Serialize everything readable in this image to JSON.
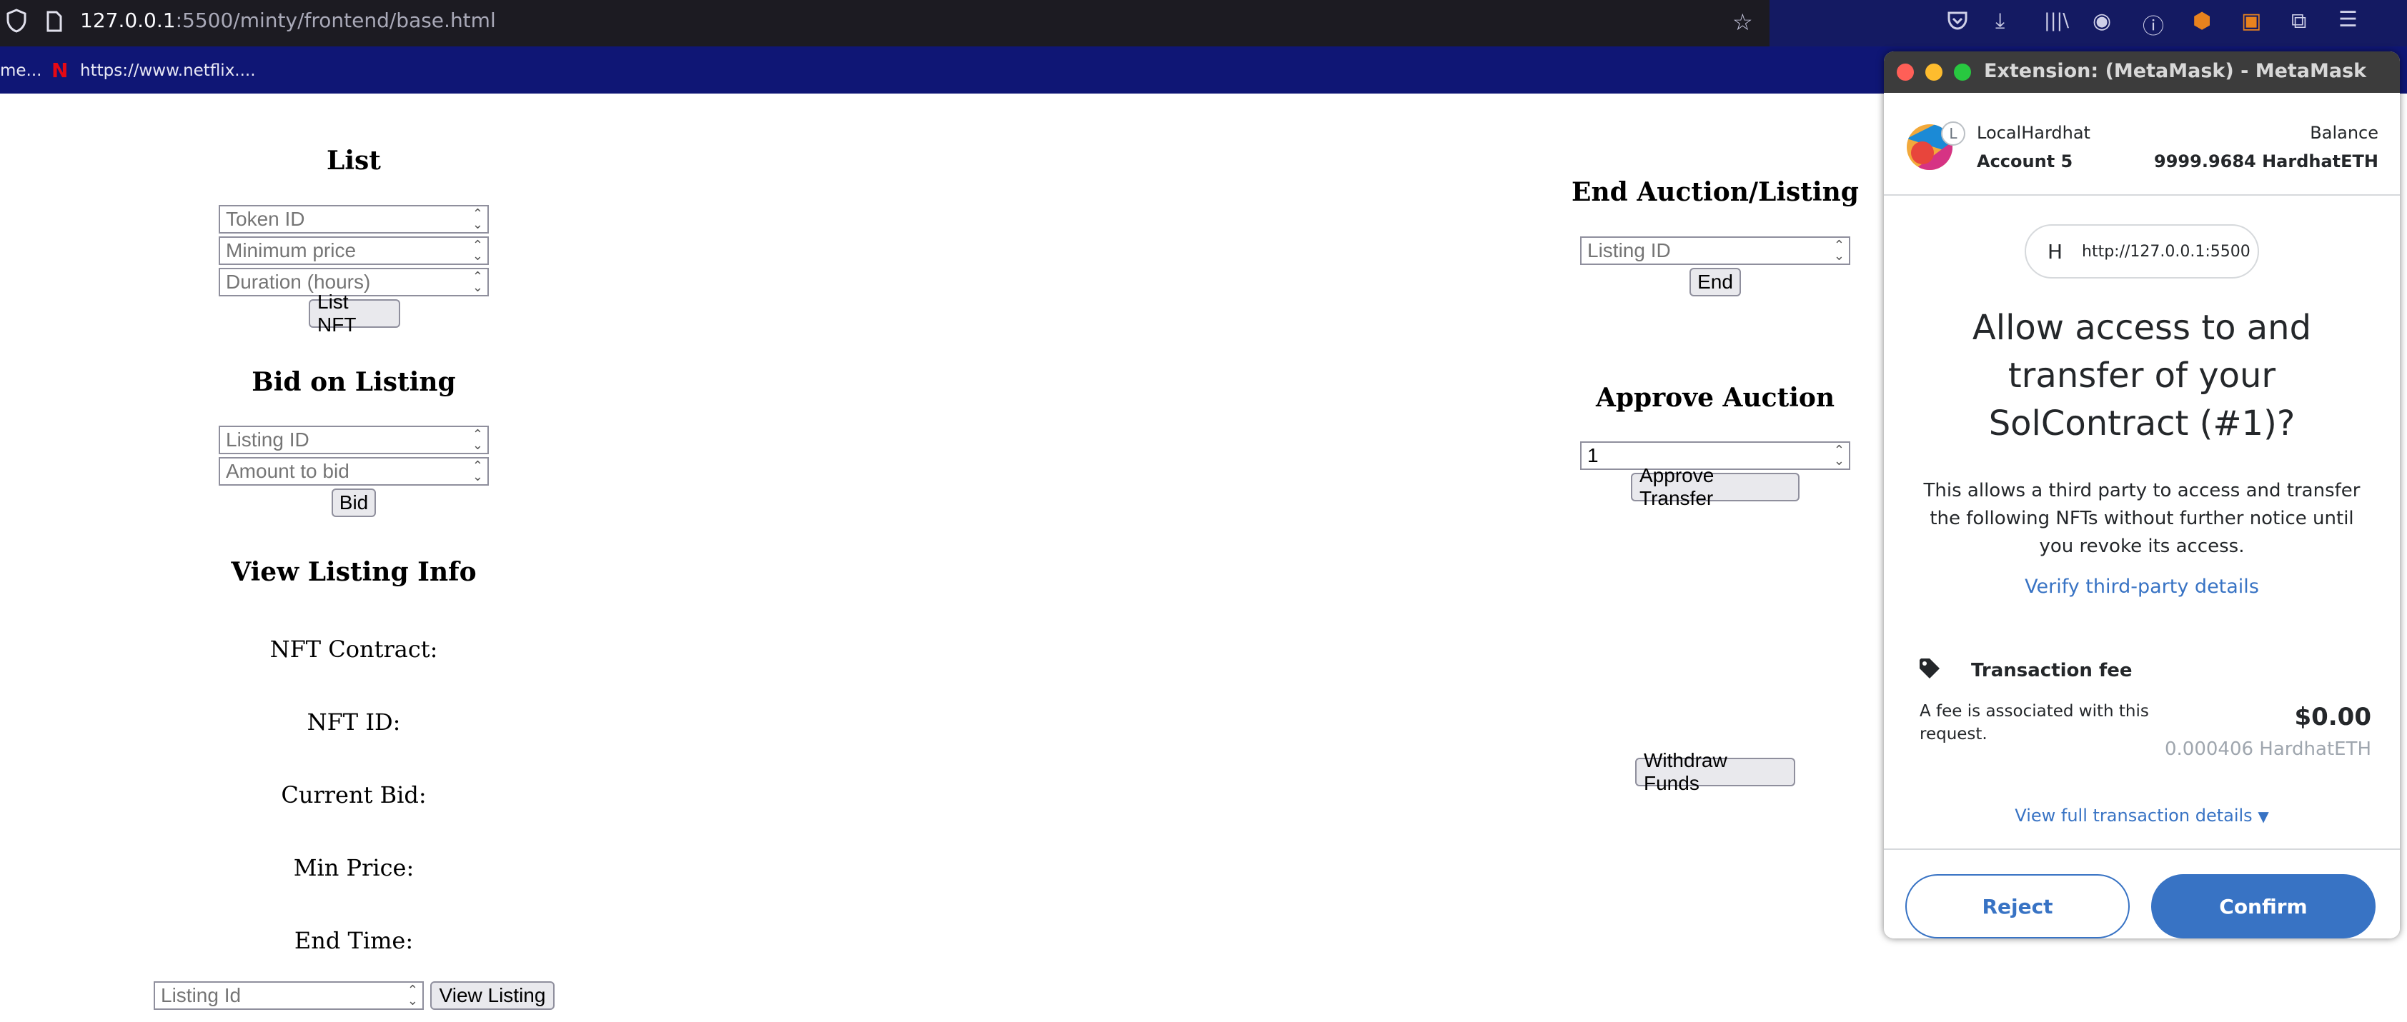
{
  "browser": {
    "url_host": "127.0.0.1",
    "url_path": ":5500/minty/frontend/base.html",
    "bookmarks": [
      {
        "label": "me..."
      },
      {
        "label": "https://www.netflix...."
      }
    ]
  },
  "list": {
    "title": "List",
    "token_id_placeholder": "Token ID",
    "min_price_placeholder": "Minimum price",
    "duration_placeholder": "Duration (hours)",
    "list_button": "List NFT"
  },
  "bid": {
    "title": "Bid on Listing",
    "listing_id_placeholder": "Listing ID",
    "amount_placeholder": "Amount to bid",
    "bid_button": "Bid"
  },
  "view_info": {
    "title": "View Listing Info",
    "nft_contract": "NFT Contract:",
    "nft_id": "NFT ID:",
    "current_bid": "Current Bid:",
    "min_price": "Min Price:",
    "end_time": "End Time:",
    "listing_id_placeholder": "Listing Id",
    "view_button": "View Listing"
  },
  "end_auction": {
    "title": "End Auction/Listing",
    "listing_id_placeholder": "Listing ID",
    "end_button": "End"
  },
  "approve": {
    "title": "Approve Auction",
    "value": "1",
    "approve_button": "Approve Transfer"
  },
  "withdraw": {
    "button": "Withdraw Funds"
  },
  "metamask": {
    "window_title": "Extension: (MetaMask) - MetaMask",
    "network": "LocalHardhat",
    "network_initial": "L",
    "account": "Account 5",
    "balance_label": "Balance",
    "balance_value": "9999.9684 HardhatETH",
    "site_initial": "H",
    "site_url": "http://127.0.0.1:5500",
    "heading": "Allow access to and transfer of your SolContract (#1)?",
    "description": "This allows a third party to access and transfer the following NFTs without further notice until you revoke its access.",
    "verify_link": "Verify third-party details",
    "fee_title": "Transaction fee",
    "fee_desc": "A fee is associated with this request.",
    "fee_usd": "$0.00",
    "fee_eth": "0.000406 HardhatETH",
    "view_details": "View full transaction details",
    "reject": "Reject",
    "confirm": "Confirm",
    "accent_color": "#3873c4"
  }
}
